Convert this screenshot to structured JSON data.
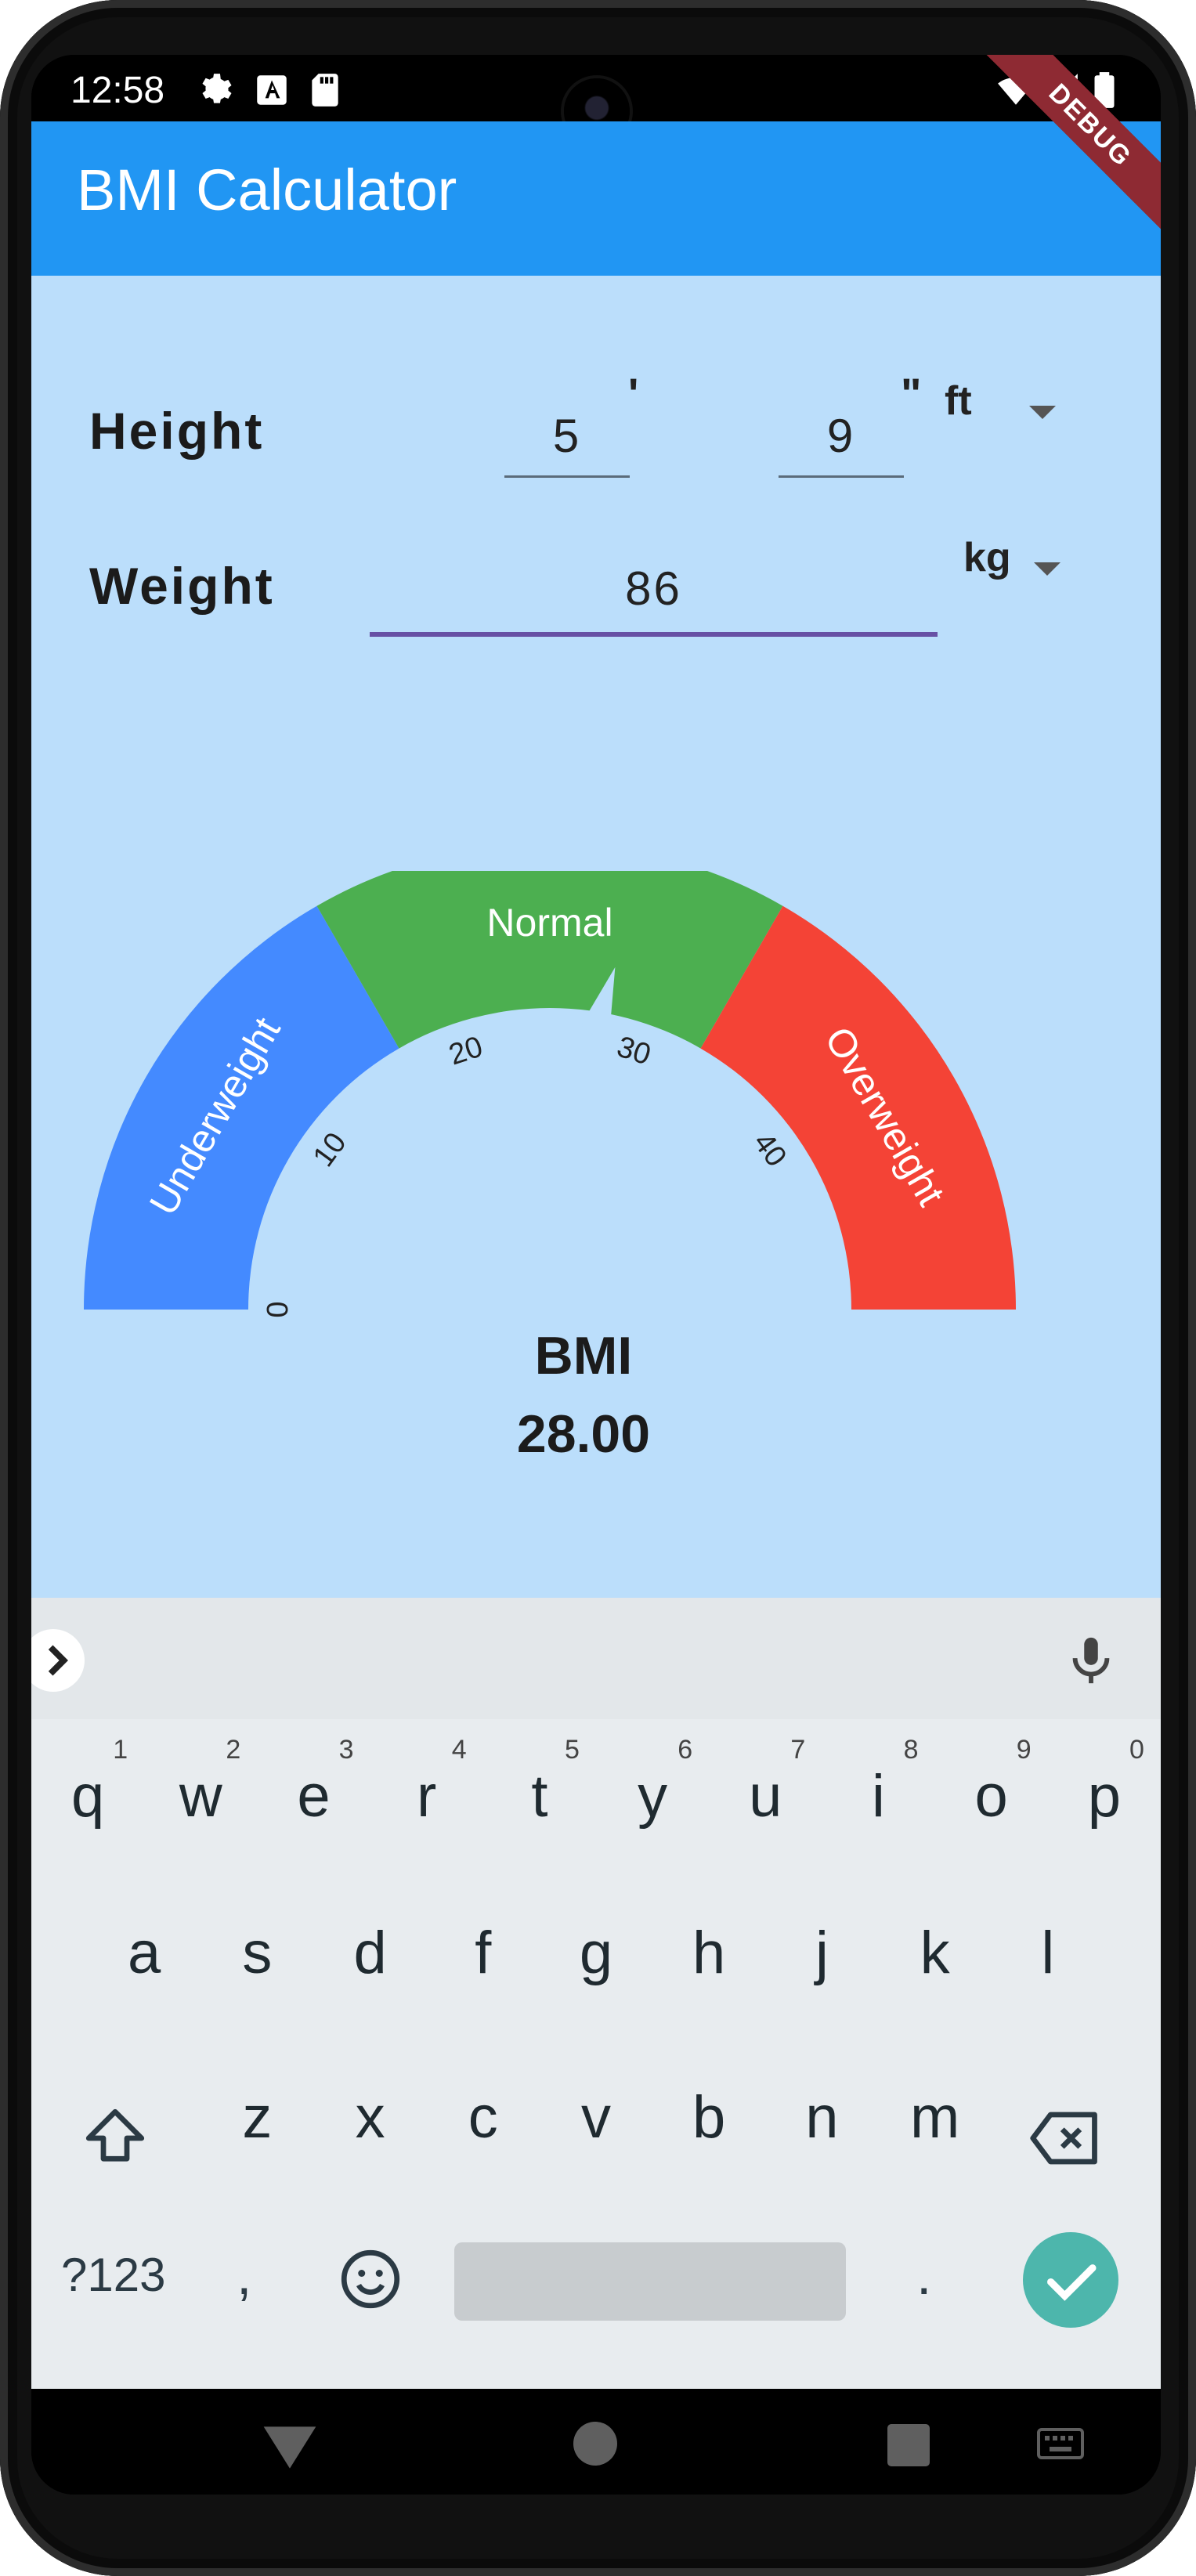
{
  "status_bar": {
    "time": "12:58",
    "icons": [
      "gear-icon",
      "text-a-icon",
      "sd-card-icon",
      "wifi-icon",
      "signal-icon",
      "battery-icon"
    ]
  },
  "debug_banner": "DEBUG",
  "app_bar": {
    "title": "BMI Calculator",
    "color": "#2196F3"
  },
  "form": {
    "height": {
      "label": "Height",
      "feet_value": "5",
      "feet_mark": "'",
      "inches_value": "9",
      "inches_mark": "\"",
      "unit": "ft"
    },
    "weight": {
      "label": "Weight",
      "value": "86",
      "unit": "kg"
    }
  },
  "gauge": {
    "segments": [
      {
        "label": "Underweight",
        "color": "#448AFF"
      },
      {
        "label": "Normal",
        "color": "#4CAF50"
      },
      {
        "label": "Overweight",
        "color": "#F44336"
      }
    ],
    "ticks": [
      "0",
      "10",
      "20",
      "30",
      "40"
    ],
    "range": [
      0,
      50
    ],
    "value": 28.0,
    "title": "BMI",
    "value_text": "28.00"
  },
  "keyboard": {
    "row1": [
      {
        "key": "q",
        "num": "1"
      },
      {
        "key": "w",
        "num": "2"
      },
      {
        "key": "e",
        "num": "3"
      },
      {
        "key": "r",
        "num": "4"
      },
      {
        "key": "t",
        "num": "5"
      },
      {
        "key": "y",
        "num": "6"
      },
      {
        "key": "u",
        "num": "7"
      },
      {
        "key": "i",
        "num": "8"
      },
      {
        "key": "o",
        "num": "9"
      },
      {
        "key": "p",
        "num": "0"
      }
    ],
    "row2": [
      "a",
      "s",
      "d",
      "f",
      "g",
      "h",
      "j",
      "k",
      "l"
    ],
    "row3": [
      "z",
      "x",
      "c",
      "v",
      "b",
      "n",
      "m"
    ],
    "symbols_key": "?123",
    "comma_key": ",",
    "period_key": ".",
    "icons": [
      "chevron-right-icon",
      "microphone-icon",
      "shift-icon",
      "backspace-icon",
      "emoji-icon",
      "check-icon"
    ]
  },
  "nav_bar": {
    "icons": [
      "back-icon",
      "home-icon",
      "recents-icon",
      "keyboard-icon"
    ]
  }
}
